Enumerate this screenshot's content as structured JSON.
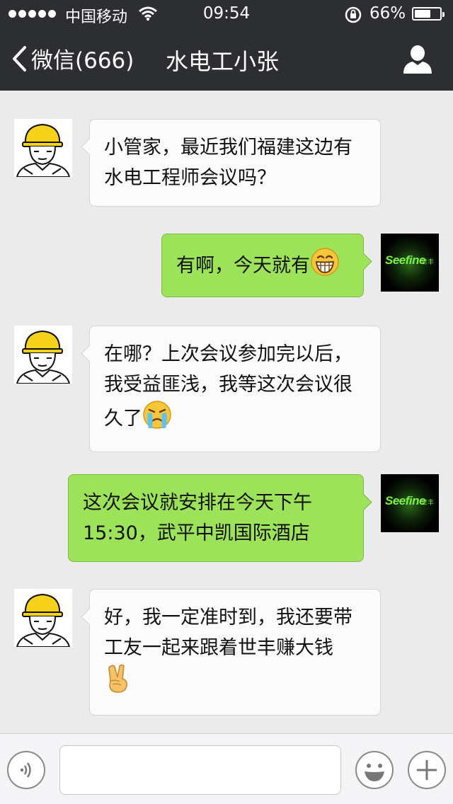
{
  "status_bar": {
    "carrier": "中国移动",
    "time": "09:54",
    "battery_percent": "66%",
    "battery_level": 0.66
  },
  "nav": {
    "back_label": "微信(666)",
    "title": "水电工小张",
    "icons": {
      "back": "chevron-left-icon",
      "profile": "person-icon"
    }
  },
  "messages": [
    {
      "side": "in",
      "text": "小管家，最近我们福建这边有水电工程师会议吗？",
      "emoji": ""
    },
    {
      "side": "out",
      "text": "有啊，今天就有",
      "emoji": "grin-emoji"
    },
    {
      "side": "in",
      "text": "在哪？上次会议参加完以后，我受益匪浅，我等这次会议很久了",
      "emoji": "crying-emoji"
    },
    {
      "side": "out",
      "text": "这次会议就安排在今天下午15:30，武平中凯国际酒店",
      "emoji": ""
    },
    {
      "side": "in",
      "text": "好，我一定准时到，我还要带工友一起来跟着世丰赚大钱",
      "emoji": "victory-hand-emoji"
    }
  ],
  "brand_avatar": {
    "text": "Seefine",
    "sub": "世丰"
  },
  "input_bar": {
    "value": "",
    "icons": {
      "voice": "voice-icon",
      "emoji": "smiley-icon",
      "more": "plus-icon"
    }
  },
  "colors": {
    "nav_bg": "#2d2e32",
    "chat_bg": "#ebebeb",
    "outgoing_bubble": "#9de35a",
    "incoming_bubble": "#fbfbfb"
  }
}
